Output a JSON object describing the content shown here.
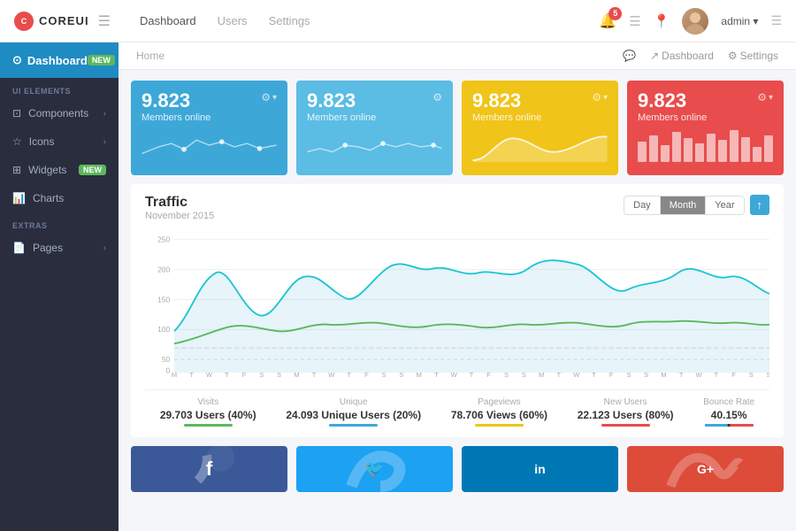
{
  "topnav": {
    "logo_text": "COREUI",
    "links": [
      "Dashboard",
      "Users",
      "Settings"
    ],
    "badge_count": "5",
    "admin_label": "admin ▾"
  },
  "sidebar": {
    "dashboard_label": "Dashboard",
    "dashboard_badge": "NEW",
    "section_ui": "UI ELEMENTS",
    "items": [
      {
        "label": "Components",
        "icon": "⊡",
        "has_chevron": true
      },
      {
        "label": "Icons",
        "icon": "☆",
        "has_chevron": true
      },
      {
        "label": "Widgets",
        "icon": "⊞",
        "badge": "NEW"
      },
      {
        "label": "Charts",
        "icon": "📈"
      }
    ],
    "section_extras": "EXTRAS",
    "extras": [
      {
        "label": "Pages",
        "icon": "📄",
        "has_chevron": true
      }
    ]
  },
  "breadcrumb": {
    "home": "Home",
    "right_items": [
      "Dashboard",
      "Settings"
    ]
  },
  "stat_cards": [
    {
      "value": "9.823",
      "label": "Members online",
      "color": "blue1"
    },
    {
      "value": "9.823",
      "label": "Members online",
      "color": "blue2"
    },
    {
      "value": "9.823",
      "label": "Members online",
      "color": "yellow"
    },
    {
      "value": "9.823",
      "label": "Members online",
      "color": "red"
    }
  ],
  "traffic": {
    "title": "Traffic",
    "subtitle": "November 2015",
    "buttons": [
      "Day",
      "Month",
      "Year"
    ],
    "active_button": "Month"
  },
  "stats_row": [
    {
      "label": "Visits",
      "value": "29.703 Users (40%)",
      "color": "#5cb85c"
    },
    {
      "label": "Unique",
      "value": "24.093 Unique Users (20%)",
      "color": "#3da8d8"
    },
    {
      "label": "Pageviews",
      "value": "78.706 Views (60%)",
      "color": "#f0c419"
    },
    {
      "label": "New Users",
      "value": "22.123 Users (80%)",
      "color": "#e84c4c"
    },
    {
      "label": "Bounce Rate",
      "value": "40.15%",
      "color": "#333"
    }
  ],
  "social_cards": [
    {
      "icon": "f",
      "color": "#3b5998"
    },
    {
      "icon": "t",
      "color": "#1da1f2"
    },
    {
      "icon": "in",
      "color": "#0077b5"
    },
    {
      "icon": "G+",
      "color": "#dd4b39"
    }
  ],
  "chart": {
    "y_labels": [
      "250",
      "200",
      "150",
      "100",
      "50",
      "0"
    ],
    "x_labels": [
      "M",
      "T",
      "W",
      "T",
      "F",
      "S",
      "S",
      "M",
      "T",
      "W",
      "T",
      "F",
      "S",
      "S",
      "M",
      "T",
      "W",
      "T",
      "F",
      "S",
      "S",
      "M",
      "T",
      "W",
      "T",
      "F",
      "S",
      "S",
      "M",
      "T",
      "W",
      "T",
      "F",
      "S",
      "S"
    ]
  }
}
